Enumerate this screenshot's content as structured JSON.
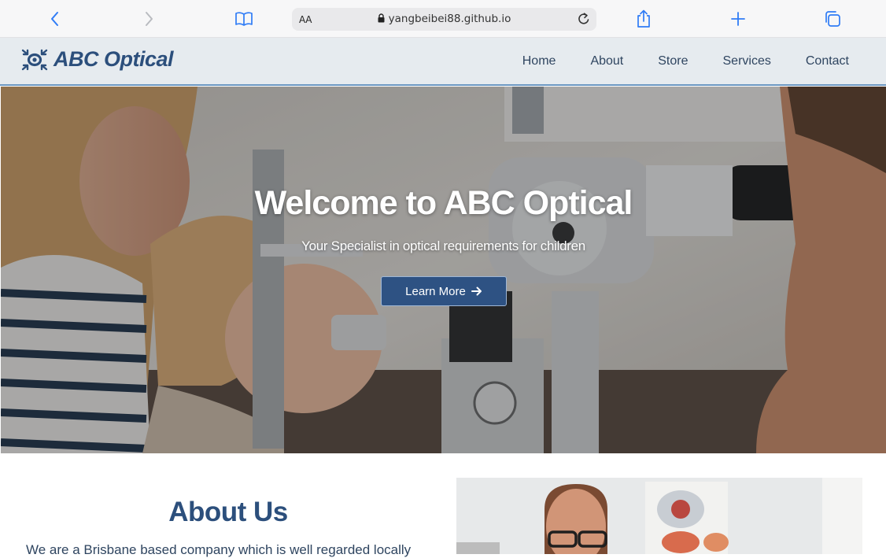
{
  "browser": {
    "aa_label": "AA",
    "url": "yangbeibei88.github.io",
    "icons": [
      "chevron-left-icon",
      "chevron-right-icon",
      "book-icon",
      "lock-icon",
      "reload-icon",
      "share-icon",
      "plus-icon",
      "tabs-icon"
    ]
  },
  "site": {
    "brand": "ABC Optical",
    "nav": {
      "home": "Home",
      "about": "About",
      "store": "Store",
      "services": "Services",
      "contact": "Contact"
    }
  },
  "hero": {
    "title": "Welcome to ABC Optical",
    "subtitle": "Your Specialist in optical requirements for children",
    "button_label": "Learn More"
  },
  "about": {
    "title": "About Us",
    "text": "We are a Brisbane based company which is well regarded locally"
  },
  "colors": {
    "brand": "#2c4f7c",
    "header_bg": "#e6ebef",
    "button_bg": "#2e5283"
  }
}
